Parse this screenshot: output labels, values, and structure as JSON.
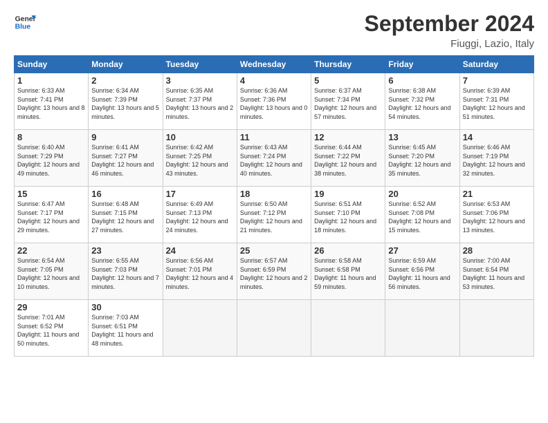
{
  "header": {
    "logo_line1": "General",
    "logo_line2": "Blue",
    "month": "September 2024",
    "location": "Fiuggi, Lazio, Italy"
  },
  "weekdays": [
    "Sunday",
    "Monday",
    "Tuesday",
    "Wednesday",
    "Thursday",
    "Friday",
    "Saturday"
  ],
  "weeks": [
    [
      {
        "day": "1",
        "sunrise": "6:33 AM",
        "sunset": "7:41 PM",
        "daylight": "13 hours and 8 minutes."
      },
      {
        "day": "2",
        "sunrise": "6:34 AM",
        "sunset": "7:39 PM",
        "daylight": "13 hours and 5 minutes."
      },
      {
        "day": "3",
        "sunrise": "6:35 AM",
        "sunset": "7:37 PM",
        "daylight": "13 hours and 2 minutes."
      },
      {
        "day": "4",
        "sunrise": "6:36 AM",
        "sunset": "7:36 PM",
        "daylight": "13 hours and 0 minutes."
      },
      {
        "day": "5",
        "sunrise": "6:37 AM",
        "sunset": "7:34 PM",
        "daylight": "12 hours and 57 minutes."
      },
      {
        "day": "6",
        "sunrise": "6:38 AM",
        "sunset": "7:32 PM",
        "daylight": "12 hours and 54 minutes."
      },
      {
        "day": "7",
        "sunrise": "6:39 AM",
        "sunset": "7:31 PM",
        "daylight": "12 hours and 51 minutes."
      }
    ],
    [
      {
        "day": "8",
        "sunrise": "6:40 AM",
        "sunset": "7:29 PM",
        "daylight": "12 hours and 49 minutes."
      },
      {
        "day": "9",
        "sunrise": "6:41 AM",
        "sunset": "7:27 PM",
        "daylight": "12 hours and 46 minutes."
      },
      {
        "day": "10",
        "sunrise": "6:42 AM",
        "sunset": "7:25 PM",
        "daylight": "12 hours and 43 minutes."
      },
      {
        "day": "11",
        "sunrise": "6:43 AM",
        "sunset": "7:24 PM",
        "daylight": "12 hours and 40 minutes."
      },
      {
        "day": "12",
        "sunrise": "6:44 AM",
        "sunset": "7:22 PM",
        "daylight": "12 hours and 38 minutes."
      },
      {
        "day": "13",
        "sunrise": "6:45 AM",
        "sunset": "7:20 PM",
        "daylight": "12 hours and 35 minutes."
      },
      {
        "day": "14",
        "sunrise": "6:46 AM",
        "sunset": "7:19 PM",
        "daylight": "12 hours and 32 minutes."
      }
    ],
    [
      {
        "day": "15",
        "sunrise": "6:47 AM",
        "sunset": "7:17 PM",
        "daylight": "12 hours and 29 minutes."
      },
      {
        "day": "16",
        "sunrise": "6:48 AM",
        "sunset": "7:15 PM",
        "daylight": "12 hours and 27 minutes."
      },
      {
        "day": "17",
        "sunrise": "6:49 AM",
        "sunset": "7:13 PM",
        "daylight": "12 hours and 24 minutes."
      },
      {
        "day": "18",
        "sunrise": "6:50 AM",
        "sunset": "7:12 PM",
        "daylight": "12 hours and 21 minutes."
      },
      {
        "day": "19",
        "sunrise": "6:51 AM",
        "sunset": "7:10 PM",
        "daylight": "12 hours and 18 minutes."
      },
      {
        "day": "20",
        "sunrise": "6:52 AM",
        "sunset": "7:08 PM",
        "daylight": "12 hours and 15 minutes."
      },
      {
        "day": "21",
        "sunrise": "6:53 AM",
        "sunset": "7:06 PM",
        "daylight": "12 hours and 13 minutes."
      }
    ],
    [
      {
        "day": "22",
        "sunrise": "6:54 AM",
        "sunset": "7:05 PM",
        "daylight": "12 hours and 10 minutes."
      },
      {
        "day": "23",
        "sunrise": "6:55 AM",
        "sunset": "7:03 PM",
        "daylight": "12 hours and 7 minutes."
      },
      {
        "day": "24",
        "sunrise": "6:56 AM",
        "sunset": "7:01 PM",
        "daylight": "12 hours and 4 minutes."
      },
      {
        "day": "25",
        "sunrise": "6:57 AM",
        "sunset": "6:59 PM",
        "daylight": "12 hours and 2 minutes."
      },
      {
        "day": "26",
        "sunrise": "6:58 AM",
        "sunset": "6:58 PM",
        "daylight": "11 hours and 59 minutes."
      },
      {
        "day": "27",
        "sunrise": "6:59 AM",
        "sunset": "6:56 PM",
        "daylight": "11 hours and 56 minutes."
      },
      {
        "day": "28",
        "sunrise": "7:00 AM",
        "sunset": "6:54 PM",
        "daylight": "11 hours and 53 minutes."
      }
    ],
    [
      {
        "day": "29",
        "sunrise": "7:01 AM",
        "sunset": "6:52 PM",
        "daylight": "11 hours and 50 minutes."
      },
      {
        "day": "30",
        "sunrise": "7:03 AM",
        "sunset": "6:51 PM",
        "daylight": "11 hours and 48 minutes."
      },
      null,
      null,
      null,
      null,
      null
    ]
  ]
}
